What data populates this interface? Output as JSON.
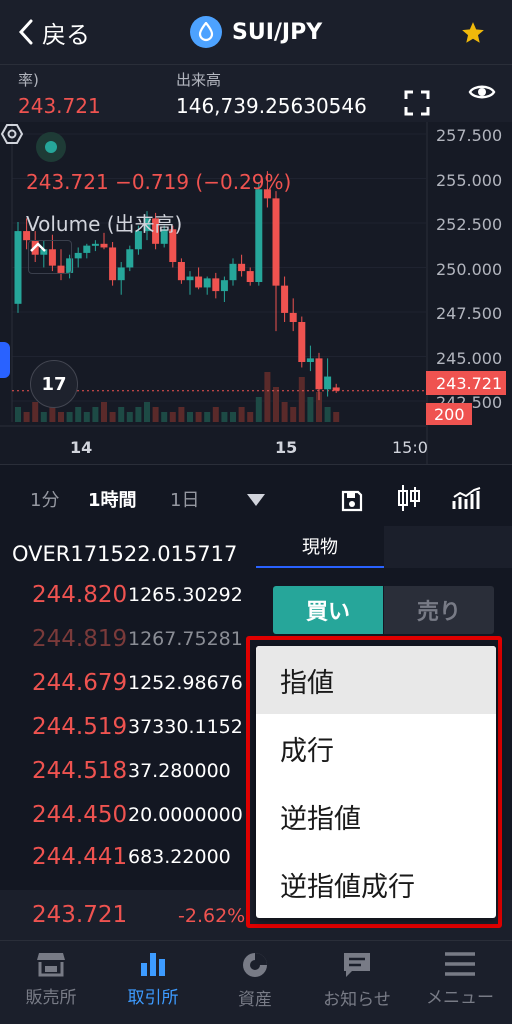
{
  "header": {
    "back_label": "戻る",
    "pair_name": "SUI/JPY"
  },
  "stats": {
    "left_label": "率)",
    "left_value": "243.721",
    "volume_label": "出来高",
    "volume_value": "146,739.25630546"
  },
  "chart": {
    "price_change_text": "243.721 −0.719 (−0.29%)",
    "volume_label": "Volume (出来高)",
    "tv_logo": "17",
    "y_ticks": [
      "257.500",
      "255.000",
      "252.500",
      "250.000",
      "247.500",
      "245.000",
      "242.500"
    ],
    "current_price_tag": "243.721",
    "volume_tag": "200",
    "x_ticks": [
      "14",
      "15",
      "15:0"
    ]
  },
  "chart_data": {
    "type": "candlestick",
    "ylim": [
      242.0,
      258.5
    ],
    "x_ticks": [
      "14",
      "15",
      "15:0"
    ],
    "current_price": 243.721,
    "candles": [
      [
        248.5,
        253.0,
        248.0,
        252.5
      ],
      [
        252.5,
        253.2,
        251.5,
        252.0
      ],
      [
        252.0,
        252.5,
        250.8,
        251.2
      ],
      [
        251.2,
        252.0,
        250.5,
        251.5
      ],
      [
        251.5,
        252.3,
        250.3,
        250.6
      ],
      [
        250.6,
        251.5,
        249.8,
        250.2
      ],
      [
        250.2,
        251.2,
        249.9,
        251.0
      ],
      [
        251.0,
        251.6,
        250.5,
        251.3
      ],
      [
        251.3,
        251.8,
        251.0,
        251.7
      ],
      [
        251.7,
        252.0,
        251.4,
        251.8
      ],
      [
        251.8,
        252.4,
        251.5,
        251.6
      ],
      [
        251.6,
        251.9,
        249.5,
        249.8
      ],
      [
        249.8,
        250.8,
        249.0,
        250.5
      ],
      [
        250.5,
        251.7,
        250.3,
        251.5
      ],
      [
        251.5,
        252.8,
        251.2,
        252.5
      ],
      [
        252.5,
        253.6,
        252.0,
        253.2
      ],
      [
        253.2,
        253.5,
        251.5,
        251.8
      ],
      [
        251.8,
        252.8,
        251.6,
        252.6
      ],
      [
        252.6,
        252.8,
        250.5,
        250.8
      ],
      [
        250.8,
        251.0,
        249.6,
        249.8
      ],
      [
        249.8,
        250.3,
        249.0,
        250.0
      ],
      [
        250.0,
        250.5,
        249.3,
        249.4
      ],
      [
        249.4,
        250.0,
        249.0,
        249.9
      ],
      [
        249.9,
        250.2,
        248.8,
        249.2
      ],
      [
        249.2,
        250.0,
        248.6,
        249.8
      ],
      [
        249.8,
        251.0,
        249.5,
        250.7
      ],
      [
        250.7,
        251.2,
        250.0,
        250.3
      ],
      [
        250.3,
        250.5,
        249.5,
        249.7
      ],
      [
        249.7,
        255.2,
        249.5,
        254.8
      ],
      [
        254.8,
        255.8,
        253.8,
        254.3
      ],
      [
        254.3,
        254.7,
        247.0,
        249.5
      ],
      [
        249.5,
        250.0,
        247.5,
        248.0
      ],
      [
        248.0,
        248.8,
        247.0,
        247.5
      ],
      [
        247.5,
        247.8,
        245.0,
        245.3
      ],
      [
        245.3,
        246.2,
        244.8,
        245.5
      ],
      [
        245.5,
        245.8,
        243.2,
        243.8
      ],
      [
        243.8,
        245.5,
        243.4,
        244.5
      ],
      [
        243.9,
        244.1,
        243.6,
        243.721
      ]
    ]
  },
  "timebar": {
    "tf_1m": "1分",
    "tf_1h": "1時間",
    "tf_1d": "1日"
  },
  "orderbook": {
    "overline_text": "OVER171522.015717",
    "tab_label": "現物",
    "rows": [
      {
        "price": "244.820",
        "qty": "1265.30292"
      },
      {
        "price": "244.819",
        "qty": "1267.75281"
      },
      {
        "price": "244.679",
        "qty": "1252.98676"
      },
      {
        "price": "244.519",
        "qty": "37330.1152"
      },
      {
        "price": "244.518",
        "qty": "37.280000"
      },
      {
        "price": "244.450",
        "qty": "20.0000000"
      },
      {
        "price": "244.441",
        "qty": "683.22000"
      }
    ],
    "last_price": "243.721",
    "last_change": "-2.62%",
    "buy_label": "買い",
    "sell_label": "売り"
  },
  "dropdown": {
    "items": [
      "指値",
      "成行",
      "逆指値",
      "逆指値成行"
    ],
    "selected_index": 0
  },
  "nav": {
    "items": [
      "販売所",
      "取引所",
      "資産",
      "お知らせ",
      "メニュー"
    ],
    "active_index": 1
  },
  "colors": {
    "up": "#26a69a",
    "down": "#ef5350",
    "accent": "#2962ff",
    "highlight": "#e00000"
  }
}
